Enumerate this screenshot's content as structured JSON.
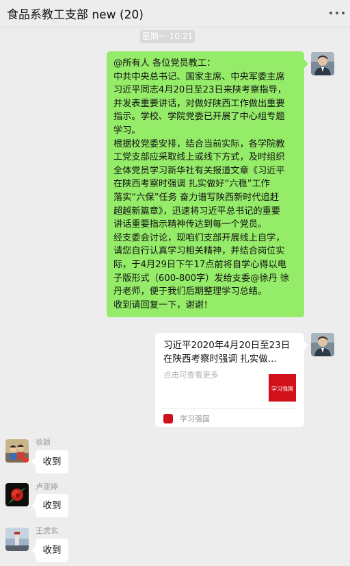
{
  "header": {
    "title": "食品系教工支部 new (20)",
    "more_icon": "more-dots-icon"
  },
  "timestamp": "星期一 10:21",
  "messages": {
    "notice": {
      "lines": [
        "@所有人 各位党员教工：",
        "中共中央总书记、国家主席、中央军委主席",
        "习近平同志4月20日至23日来陕考察指导，",
        "并发表重要讲话，对做好陕西工作做出重要",
        "指示。学校、学院党委已开展了中心组专题",
        "学习。",
        "根据校党委安排，结合当前实际，各学院教",
        "工党支部应采取线上或线下方式，及时组织",
        "全体党员学习新华社有关报道文章《习近平",
        "在陕西考察时强调 扎实做好“六稳”工作",
        "落实“六保”任务 奋力谱写陕西新时代追赶",
        "超越新篇章》，迅速将习近平总书记的重要",
        "讲话重要指示精神传达到每一个党员。",
        "经支委会讨论，现咱们支部开展线上自学，",
        "请您自行认真学习相关精神，并结合岗位实",
        "际，于4月29日下午17点前将自学心得以电",
        "子版形式（600-800字）发给支委@徐丹 徐",
        "丹老师，便于我们后期整理学习总结。",
        "    收到请回复一下，谢谢！"
      ]
    },
    "card": {
      "title": "习近平2020年4月20日至23日在陕西考察时强调 扎实做...",
      "desc": "点击可查看更多",
      "thumb_text": "学习强国",
      "source": "学习强国"
    },
    "replies": [
      {
        "sender": "徐颖",
        "text": "收到"
      },
      {
        "sender": "卢亚婷",
        "text": "收到"
      },
      {
        "sender": "王虎玄",
        "text": "收到"
      }
    ]
  },
  "colors": {
    "background": "#ededed",
    "self_bubble": "#95ec69",
    "other_bubble": "#ffffff",
    "xuexi_red": "#d0101b"
  }
}
